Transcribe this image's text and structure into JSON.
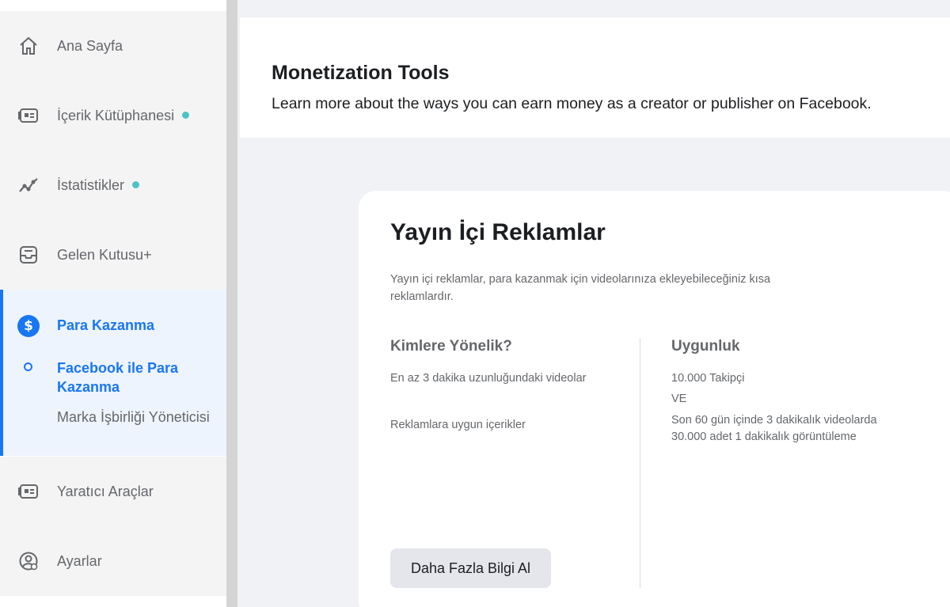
{
  "sidebar": {
    "items": [
      {
        "label": "Ana Sayfa",
        "icon": "home-icon"
      },
      {
        "label": "İçerik Kütüphanesi",
        "icon": "content-library-icon",
        "dot": true
      },
      {
        "label": "İstatistikler",
        "icon": "insights-icon",
        "dot": true
      },
      {
        "label": "Gelen Kutusu+",
        "icon": "inbox-icon"
      },
      {
        "label": "Yaratıcı Araçlar",
        "icon": "creative-tools-icon"
      },
      {
        "label": "Ayarlar",
        "icon": "settings-icon"
      }
    ],
    "monetization": {
      "label": "Para Kazanma",
      "icon": "dollar-icon",
      "sub_items": [
        {
          "label": "Facebook ile Para Kazanma",
          "active": true
        },
        {
          "label": "Marka İşbirliği Yöneticisi",
          "active": false
        }
      ]
    }
  },
  "header": {
    "title": "Monetization Tools",
    "subtitle": "Learn more about the ways you can earn money as a creator or publisher on Facebook."
  },
  "card": {
    "title": "Yayın İçi Reklamlar",
    "description": "Yayın içi reklamlar, para kazanmak için videolarınıza ekleyebileceğiniz kısa reklamlardır.",
    "who_for": {
      "heading": "Kimlere Yönelik?",
      "items": [
        "En az 3 dakika uzunluğundaki videolar",
        "Reklamlara uygun içerikler"
      ]
    },
    "eligibility": {
      "heading": "Uygunluk",
      "items": [
        "10.000 Takipçi",
        "VE",
        "Son 60 gün içinde 3 dakikalık videolarda 30.000 adet 1 dakikalık görüntüleme"
      ]
    },
    "button_label": "Daha Fazla Bilgi Al"
  },
  "colors": {
    "accent": "#1877f2",
    "dot": "#4ec3c4"
  }
}
